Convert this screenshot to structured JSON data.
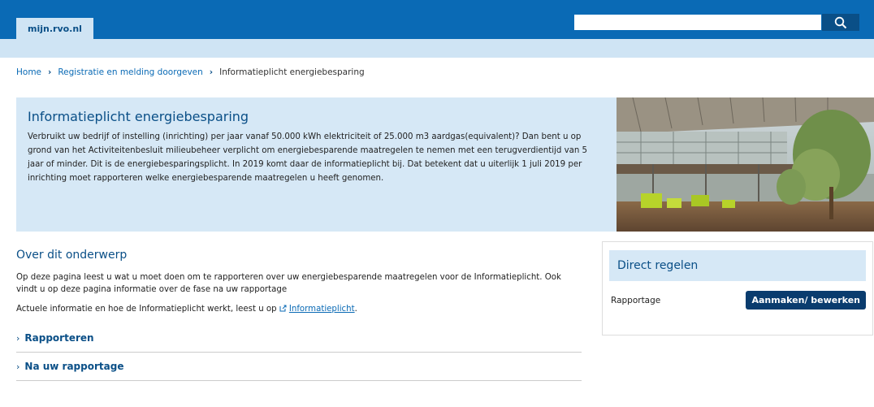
{
  "header": {
    "logo_text": "mijn.rvo.nl",
    "search_value": "",
    "search_icon": "search-icon",
    "brand_color": "#0a6ab5"
  },
  "breadcrumb": {
    "items": [
      "Home",
      "Registratie en melding doorgeven"
    ],
    "current": "Informatieplicht energiebesparing"
  },
  "hero": {
    "title": "Informatieplicht energiebesparing",
    "text": "Verbruikt uw bedrijf of instelling (inrichting) per jaar vanaf 50.000 kWh elektriciteit of 25.000 m3 aardgas(equivalent)? Dan bent u op grond van het Activiteitenbesluit milieubeheer verplicht om energiebesparende maatregelen te nemen met een terugverdientijd van 5 jaar of minder. Dit is de energiebesparingsplicht. In 2019 komt daar de informatieplicht bij. Dat betekent dat u uiterlijk 1 juli 2019 per inrichting moet rapporteren welke energiebesparende maatregelen u heeft genomen."
  },
  "main": {
    "title": "Over dit onderwerp",
    "para1": "Op deze pagina leest u wat u moet doen om te rapporteren over uw energiebesparende maatregelen voor de Informatieplicht. Ook vindt u op deze pagina informatie over de fase na uw rapportage",
    "para2_prefix": "Actuele informatie en hoe de Informatieplicht werkt, leest u op",
    "para2_link": "Informatieplicht",
    "para2_suffix": ".",
    "accordion": [
      "Rapporteren",
      "Na uw rapportage"
    ]
  },
  "sidebar": {
    "title": "Direct regelen",
    "row_label": "Rapportage",
    "button_label": "Aanmaken/ bewerken"
  }
}
